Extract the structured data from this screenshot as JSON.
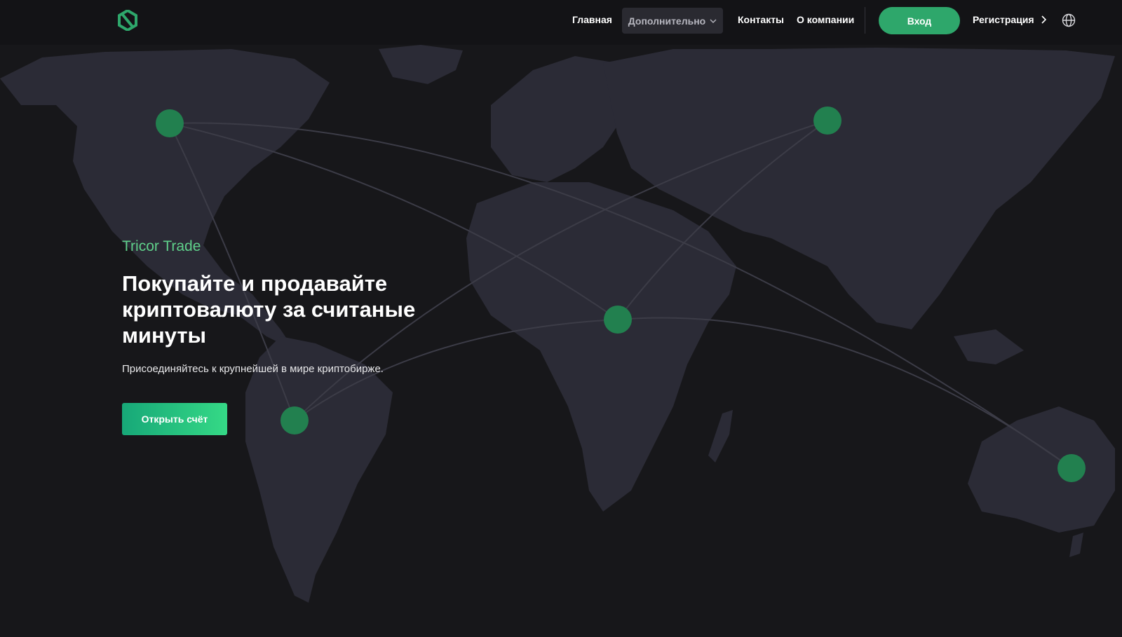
{
  "colors": {
    "background": "#17171a",
    "land": "#2b2b36",
    "node": "#22804f",
    "accent": "#2ea76b",
    "brand_text": "#5fd08a"
  },
  "header": {
    "logo_icon": "hexagon-logo-icon",
    "nav": {
      "home": "Главная",
      "more": "Дополнительно",
      "contacts": "Контакты",
      "about": "О компании"
    },
    "login_label": "Вход",
    "register_label": "Регистрация",
    "language_icon": "globe-icon"
  },
  "hero": {
    "brand": "Tricor Trade",
    "headline": "Покупайте и продавайте криптовалюту за считаные минуты",
    "subtitle": "Присоединяйтесь к крупнейшей в мире криптобирже.",
    "cta_label": "Открыть счёт"
  }
}
